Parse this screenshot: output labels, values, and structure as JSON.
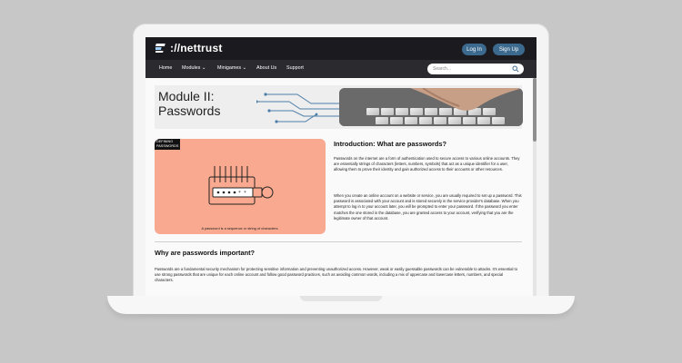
{
  "site": {
    "logo_text": "://nettrust",
    "login": "Log In",
    "signup": "Sign Up"
  },
  "nav": {
    "items": [
      "Home",
      "Modules ⌄",
      "Minigames ⌄",
      "About Us",
      "Support"
    ],
    "search_placeholder": "Search..."
  },
  "banner": {
    "line1": "Module II:",
    "line2": "Passwords"
  },
  "card": {
    "tag_line1": "DEFINING",
    "tag_line2": "PASSWORDS",
    "caption": "A password is a sequence or string of characters."
  },
  "intro": {
    "heading": "Introduction: What are passwords?",
    "p1": "Passwords on the internet are a form of authentication used to secure access to various online accounts. They are essentially strings of characters (letters, numbers, symbols) that act as a unique identifier for a user, allowing them to prove their identity and gain authorized access to their accounts or other resources.",
    "p2": "When you create an online account on a website or service, you are usually required to set up a password. This password is associated with your account and is stored securely in the service provider's database. When you attempt to log in to your account later, you will be prompted to enter your password. If the password you enter matches the one stored in the database, you are granted access to your account, verifying that you are the legitimate owner of that account."
  },
  "why": {
    "heading": "Why are passwords important?",
    "p": "Passwords are a fundamental security mechanism for protecting sensitive information and preventing unauthorized access. However, weak or easily guessable passwords can be vulnerable to attacks. It's essential to use strong passwords that are unique for each online account and follow good password practices, such as avoiding common words, including a mix of uppercase and lowercase letters, numbers, and special characters."
  },
  "colors": {
    "topbar": "#1b1b1f",
    "navbar": "#2a2a2f",
    "button": "#3c6a8e",
    "card": "#f9a98f"
  }
}
